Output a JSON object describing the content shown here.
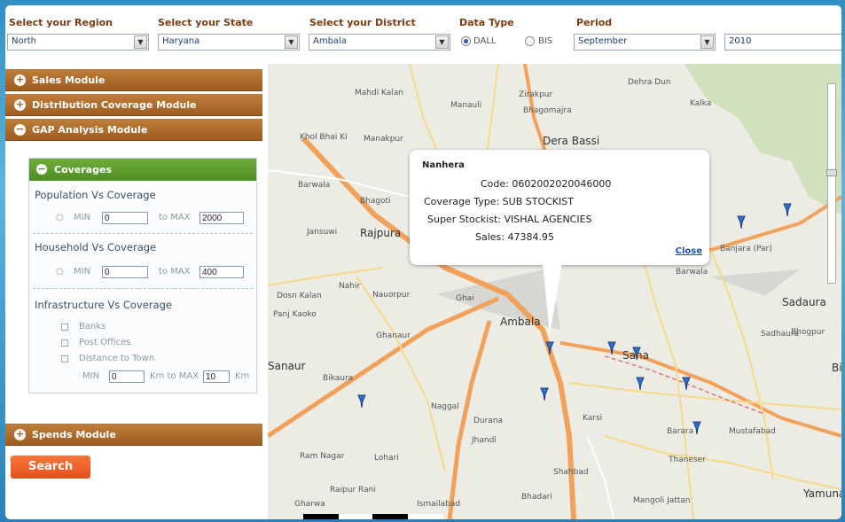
{
  "filters": {
    "region_label": "Select your Region",
    "region_value": "North",
    "state_label": "Select your State",
    "state_value": "Haryana",
    "district_label": "Select your District",
    "district_value": "Ambala",
    "datatype_label": "Data Type",
    "dall_label": "DALL",
    "bis_label": "BIS",
    "period_label": "Period",
    "month_value": "September",
    "year_value": "2010"
  },
  "modules": {
    "sales": "Sales Module",
    "distribution": "Distribution Coverage Module",
    "gap": "GAP Analysis Module",
    "spends": "Spends Module"
  },
  "coverages": {
    "title": "Coverages",
    "population": {
      "label": "Population Vs Coverage",
      "min_label": "MIN",
      "min_value": "0",
      "max_label": "to MAX",
      "max_value": "2000"
    },
    "household": {
      "label": "Household Vs Coverage",
      "min_label": "MIN",
      "min_value": "0",
      "max_label": "to MAX",
      "max_value": "400"
    },
    "infrastructure": {
      "label": "Infrastructure Vs Coverage",
      "banks": "Banks",
      "post_offices": "Post Offices",
      "distance": "Distance to Town",
      "min_label": "MIN",
      "min_value": "0",
      "mid_label": "Km to MAX",
      "max_value": "10",
      "unit": "Km"
    }
  },
  "search_label": "Search",
  "infobox": {
    "title": "Nanhera",
    "code": "Code: 0602002020046000",
    "coverage_type": "Coverage Type: SUB STOCKIST",
    "super_stockist": "Super Stockist: VISHAL AGENCIES",
    "sales": "Sales: 47384.95",
    "close": "Close"
  },
  "map": {
    "places": [
      "Mahdi Kalan",
      "Manauli",
      "Zirakpur",
      "Bhagomajra",
      "Dera Bassi",
      "Khol Bhai Ki",
      "Manakpur",
      "Barwala",
      "Bhagoti",
      "Jansuwi",
      "Rajpura",
      "Dosn Kalan",
      "Panj Kaoko",
      "Nahir",
      "Nauorpur",
      "Ghai",
      "Ambala",
      "Ghanaur",
      "Saha",
      "Sanaur",
      "Bikaura",
      "Naggal",
      "Durana",
      "Karsi",
      "Jhandi",
      "Barara",
      "Mustafabad",
      "Shahbad",
      "Bhadari",
      "Yamuna",
      "Sadaura",
      "Bi",
      "Raipur Rani",
      "Ismailabad",
      "Gharwa",
      "Thaneser",
      "Ram Nagar",
      "Lohari",
      "Dehra Dun",
      "Kalka",
      "Barwala",
      "Sadhaura",
      "Bhogpur",
      "Banjara (Par)",
      "Mangoli Jattan"
    ]
  }
}
